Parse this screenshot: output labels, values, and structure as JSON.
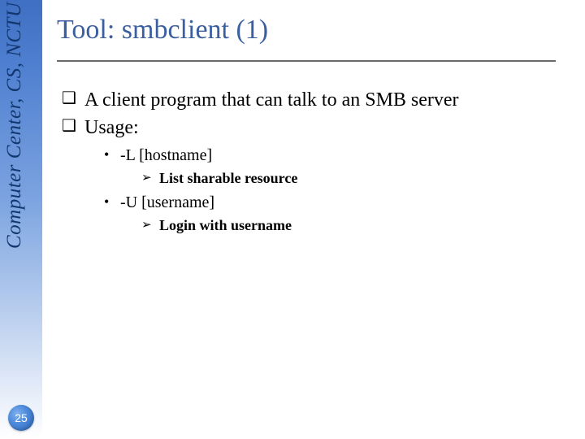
{
  "sidebar": {
    "label": "Computer Center, CS, NCTU"
  },
  "page_number": "25",
  "title": "Tool: smbclient (1)",
  "bullets": {
    "b1": "A client program that can talk to an SMB server",
    "b2": "Usage:",
    "b2a": "-L [hostname]",
    "b2a_i": "List sharable resource",
    "b2b": "-U [username]",
    "b2b_i": "Login with username"
  }
}
